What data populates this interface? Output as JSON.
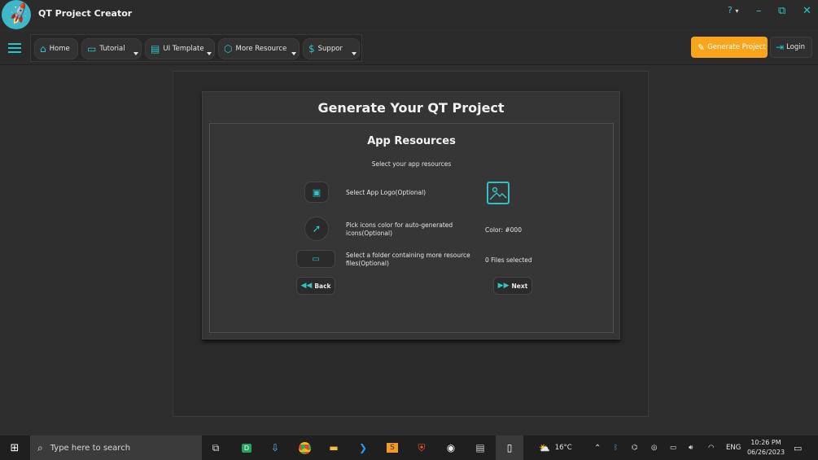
{
  "titlebar": {
    "app_title": "QT Project Creator",
    "help_icon": "?",
    "minimize_icon": "–",
    "restore_icon": "⧉",
    "close_icon": "✕"
  },
  "nav": {
    "items": [
      {
        "label": "Home",
        "icon": "home-icon"
      },
      {
        "label": "Tutorial",
        "icon": "monitor-icon"
      },
      {
        "label": "UI Template",
        "icon": "template-icon"
      },
      {
        "label": "More Resource",
        "icon": "cube-icon"
      },
      {
        "label": "Suppor",
        "icon": "dollar-icon"
      }
    ],
    "generate_label": "Generate Project",
    "login_label": "Login"
  },
  "main": {
    "title": "Generate Your QT Project",
    "section_title": "App Resources",
    "section_subtitle": "Select your app resources",
    "rows": [
      {
        "label": "Select App Logo(Optional)",
        "value": ""
      },
      {
        "label": "Pick icons color for auto-generated icons(Optional)",
        "value": "Color: #000"
      },
      {
        "label": "Select a folder containing more resource files(Optional)",
        "value": "0 Files selected"
      }
    ],
    "back_label": "Back",
    "next_label": "Next"
  },
  "taskbar": {
    "search_placeholder": "Type here to search",
    "weather": "16°C",
    "language": "ENG",
    "time": "10:26 PM",
    "date": "06/26/2023"
  },
  "colors": {
    "accent": "#2fc4c4",
    "generate_button": "#f8a51c",
    "background": "#2e2e2e"
  }
}
